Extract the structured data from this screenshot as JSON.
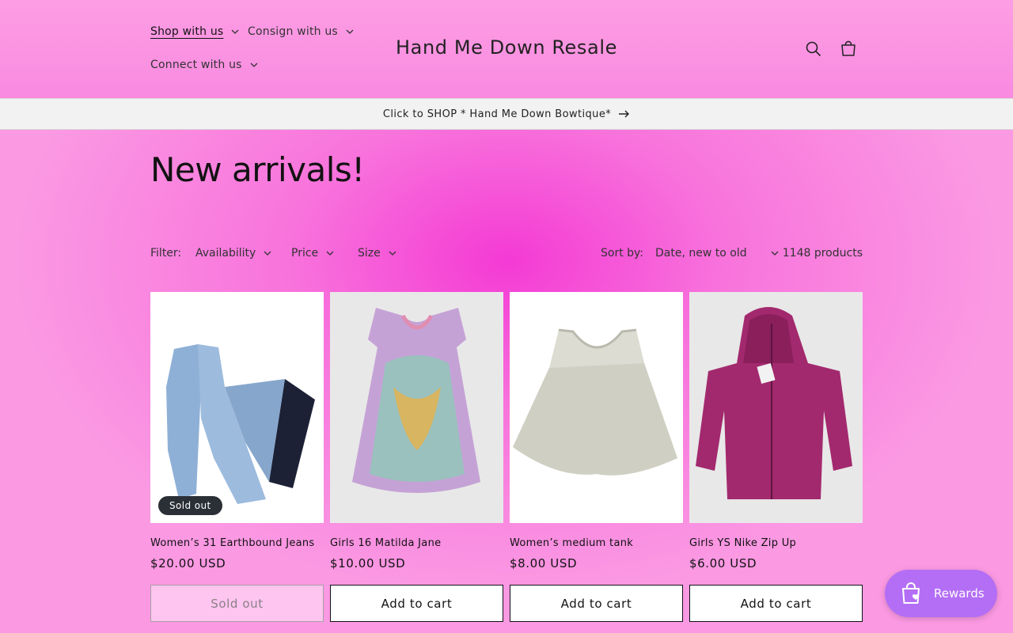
{
  "header": {
    "nav": [
      {
        "label": "Shop with us"
      },
      {
        "label": "Consign with us"
      },
      {
        "label": "Connect with us"
      }
    ],
    "site_title": "Hand Me Down Resale",
    "icons": {
      "search": "search-icon",
      "cart": "cart-icon"
    }
  },
  "announcement": {
    "text": "Click to SHOP * Hand Me Down Bowtique*",
    "icon": "arrow-right-icon"
  },
  "collection": {
    "title": "New arrivals!"
  },
  "filters": {
    "label": "Filter:",
    "items": [
      {
        "label": "Availability"
      },
      {
        "label": "Price"
      },
      {
        "label": "Size"
      }
    ],
    "sort_label": "Sort by:",
    "sort_value": "Date, new to old",
    "product_count": "1148 products"
  },
  "products": [
    {
      "name": "Women’s 31 Earthbound Jeans",
      "price": "$20.00 USD",
      "badge": "Sold out",
      "button": "Sold out"
    },
    {
      "name": "Girls 16 Matilda Jane",
      "price": "$10.00 USD",
      "button": "Add to cart"
    },
    {
      "name": "Women’s medium tank",
      "price": "$8.00 USD",
      "button": "Add to cart"
    },
    {
      "name": "Girls YS Nike Zip Up",
      "price": "$6.00 USD",
      "button": "Add to cart"
    }
  ],
  "rewards": {
    "label": "Rewards",
    "icon": "shopping-bag-heart-icon"
  },
  "colors": {
    "accent_pink": "#f43ad4",
    "rewards_purple": "#b36ef5",
    "sold_out_bg": "#fec5f0"
  }
}
